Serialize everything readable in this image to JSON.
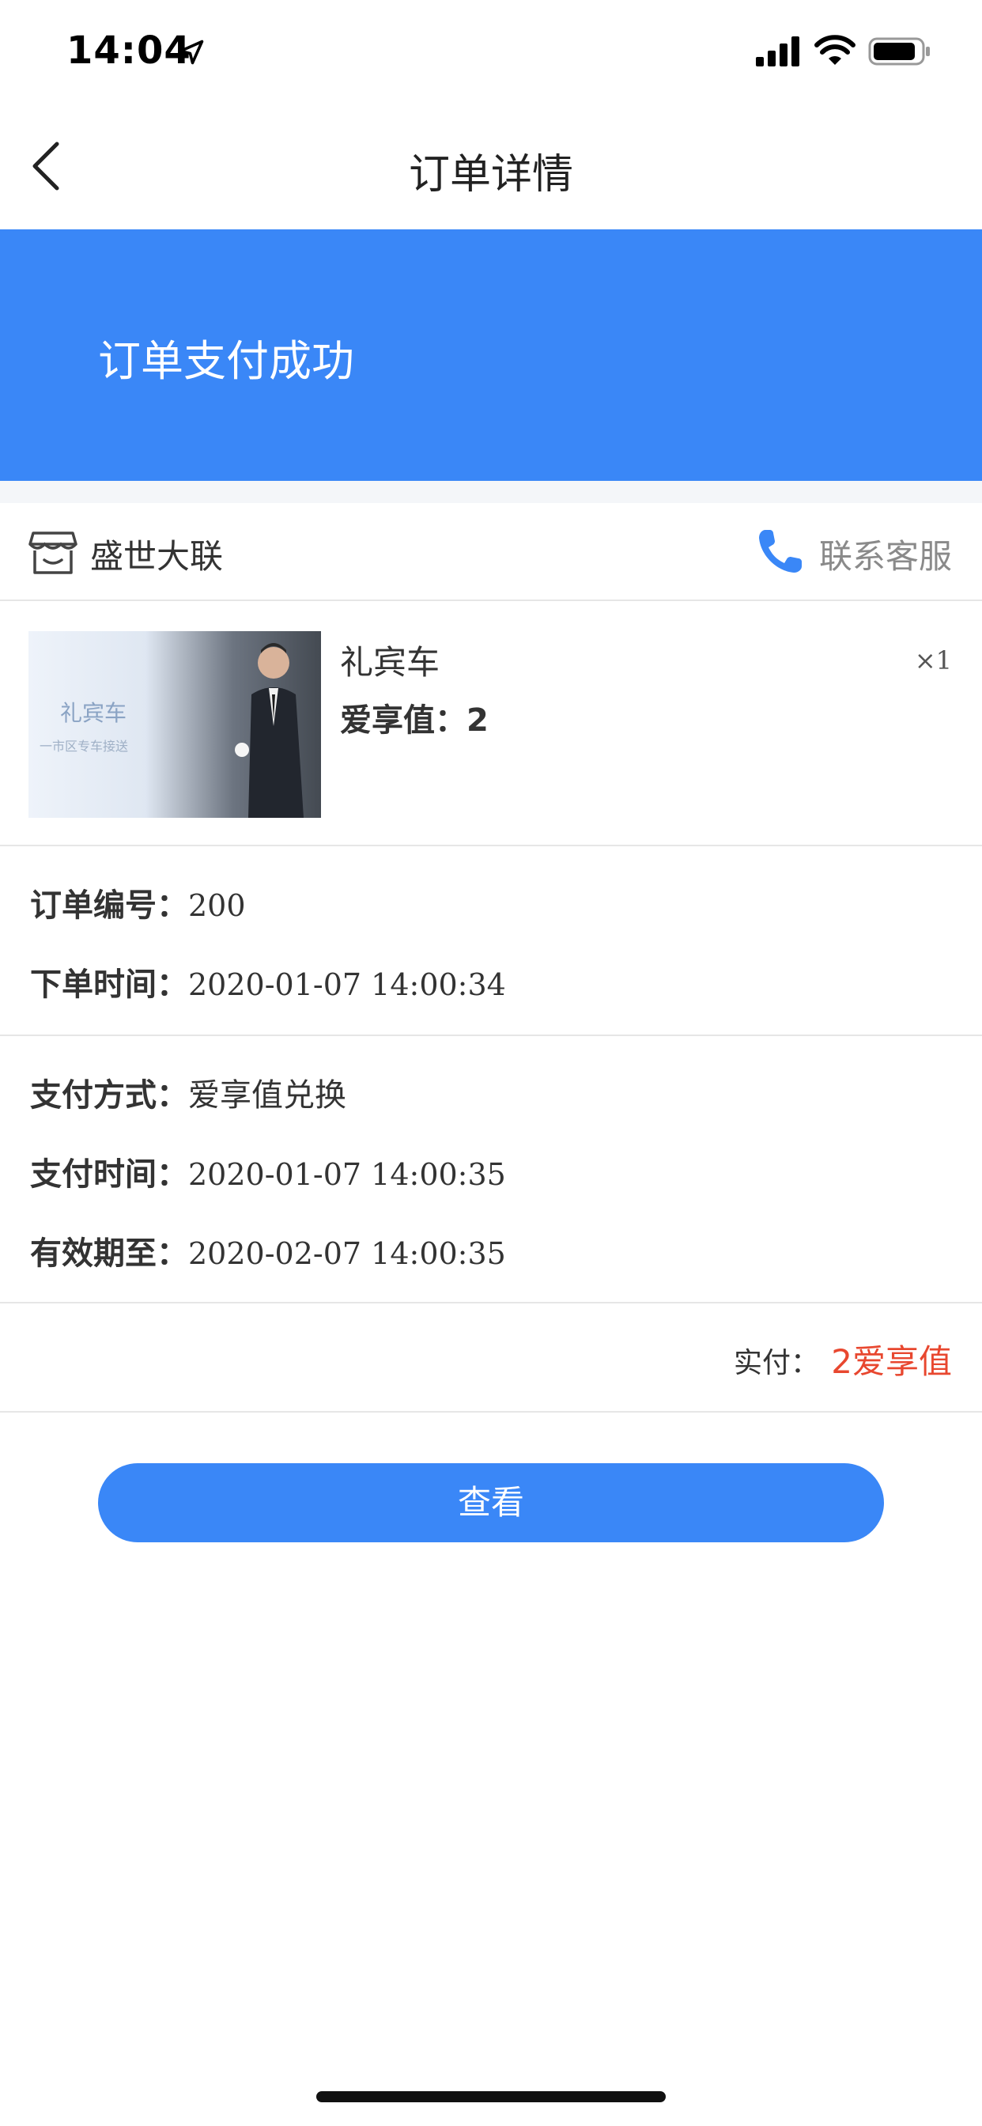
{
  "status_bar": {
    "time": "14:04",
    "icons": [
      "location-arrow-icon",
      "signal-icon",
      "wifi-icon",
      "battery-icon"
    ]
  },
  "nav": {
    "title": "订单详情",
    "back_icon": "chevron-left-icon"
  },
  "banner": {
    "text": "订单支付成功",
    "color": "#3a87f7"
  },
  "shop": {
    "name": "盛世大联",
    "icon": "store-icon",
    "contact_label": "联系客服",
    "contact_icon": "phone-icon"
  },
  "product": {
    "name": "礼宾车",
    "price_label": "爱享值：2",
    "quantity": "×1",
    "thumb_title": "礼宾车",
    "thumb_subtitle": "一市区专车接送"
  },
  "order_info": [
    {
      "label": "订单编号：",
      "value": "200"
    },
    {
      "label": "下单时间：",
      "value": "2020-01-07 14:00:34"
    }
  ],
  "payment_info": [
    {
      "label": "支付方式：",
      "value": "爱享值兑换"
    },
    {
      "label": "支付时间：",
      "value": "2020-01-07 14:00:35"
    },
    {
      "label": "有效期至：",
      "value": "2020-02-07 14:00:35"
    }
  ],
  "total": {
    "label": "实付：",
    "value": "2爱享值",
    "color": "#e8472f"
  },
  "actions": {
    "view_label": "查看"
  }
}
